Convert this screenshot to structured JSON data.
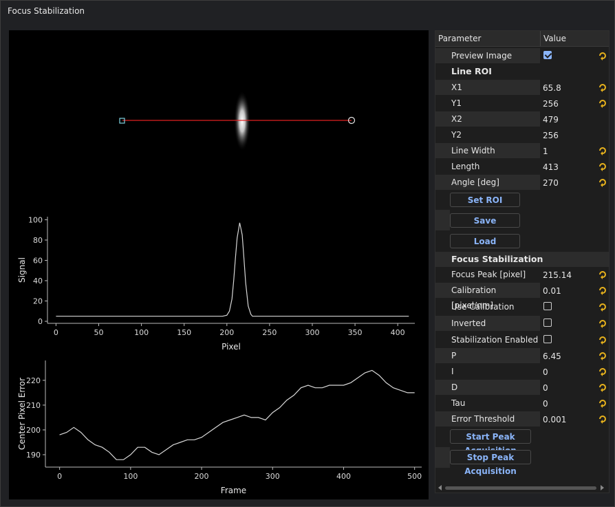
{
  "window": {
    "title": "Focus Stabilization"
  },
  "colors": {
    "roi_line": "#e02020",
    "accent": "#8ab4f8",
    "reset_icon": "#e8b21c",
    "trace": "#d8d8d8"
  },
  "params": {
    "header": {
      "parameter": "Parameter",
      "value": "Value"
    },
    "preview_image": {
      "label": "Preview Image",
      "checked": true
    },
    "line_roi": {
      "title": "Line ROI",
      "rows": [
        {
          "label": "X1",
          "value": "65.8"
        },
        {
          "label": "Y1",
          "value": "256"
        },
        {
          "label": "X2",
          "value": "479"
        },
        {
          "label": "Y2",
          "value": "256"
        },
        {
          "label": "Line Width",
          "value": "1"
        },
        {
          "label": "Length",
          "value": "413"
        },
        {
          "label": "Angle [deg]",
          "value": "270"
        }
      ],
      "buttons": {
        "set_roi": "Set ROI",
        "save": "Save",
        "load": "Load"
      }
    },
    "focus": {
      "title": "Focus Stabilization",
      "rows": [
        {
          "label": "Focus Peak [pixel]",
          "value": "215.14"
        },
        {
          "label": "Calibration [pixel/nm]",
          "value": "0.01"
        },
        {
          "label": "Use Calibration",
          "checked": false
        },
        {
          "label": "Inverted",
          "checked": false
        },
        {
          "label": "Stabilization Enabled",
          "checked": false
        },
        {
          "label": "P",
          "value": "6.45"
        },
        {
          "label": "I",
          "value": "0"
        },
        {
          "label": "D",
          "value": "0"
        },
        {
          "label": "Tau",
          "value": "0"
        },
        {
          "label": "Error Threshold",
          "value": "0.001"
        }
      ],
      "buttons": {
        "start": "Start Peak Acquisition",
        "stop": "Stop Peak Acquisition"
      }
    }
  },
  "chart_data": [
    {
      "type": "line",
      "xlabel": "Pixel",
      "ylabel": "Signal",
      "xlim": [
        -10,
        420
      ],
      "ylim": [
        -2,
        103
      ],
      "xticks": [
        0,
        50,
        100,
        150,
        200,
        250,
        300,
        350,
        400
      ],
      "yticks": [
        0,
        20,
        40,
        60,
        80,
        100
      ],
      "x": [
        0,
        25,
        50,
        75,
        100,
        125,
        150,
        175,
        195,
        200,
        203,
        206,
        208,
        210,
        212,
        214,
        215,
        216,
        218,
        220,
        222,
        225,
        228,
        230,
        235,
        260,
        300,
        350,
        400,
        413
      ],
      "y": [
        5,
        5,
        5,
        5,
        5,
        5,
        5,
        5,
        5,
        6,
        10,
        22,
        40,
        62,
        82,
        92,
        97,
        93,
        85,
        62,
        38,
        15,
        7,
        5,
        5,
        5,
        5,
        5,
        5,
        5
      ]
    },
    {
      "type": "line",
      "xlabel": "Frame",
      "ylabel": "Center Pixel Error",
      "xlim": [
        -20,
        510
      ],
      "ylim": [
        185,
        228
      ],
      "xticks": [
        0,
        100,
        200,
        300,
        400,
        500
      ],
      "yticks": [
        190,
        200,
        210,
        220
      ],
      "x": [
        0,
        10,
        20,
        30,
        40,
        50,
        60,
        70,
        80,
        90,
        100,
        110,
        120,
        130,
        140,
        150,
        160,
        170,
        180,
        190,
        200,
        210,
        220,
        230,
        240,
        250,
        260,
        270,
        280,
        290,
        300,
        310,
        320,
        330,
        340,
        350,
        360,
        370,
        380,
        390,
        400,
        410,
        420,
        430,
        440,
        450,
        460,
        470,
        480,
        490,
        500
      ],
      "y": [
        198,
        199,
        201,
        199,
        196,
        194,
        193,
        191,
        188,
        188,
        190,
        193,
        193,
        191,
        190,
        192,
        194,
        195,
        196,
        196,
        197,
        199,
        201,
        203,
        204,
        205,
        206,
        205,
        205,
        204,
        207,
        209,
        212,
        214,
        217,
        218,
        217,
        217,
        218,
        218,
        218,
        219,
        221,
        223,
        224,
        222,
        219,
        217,
        216,
        215,
        215
      ]
    }
  ]
}
